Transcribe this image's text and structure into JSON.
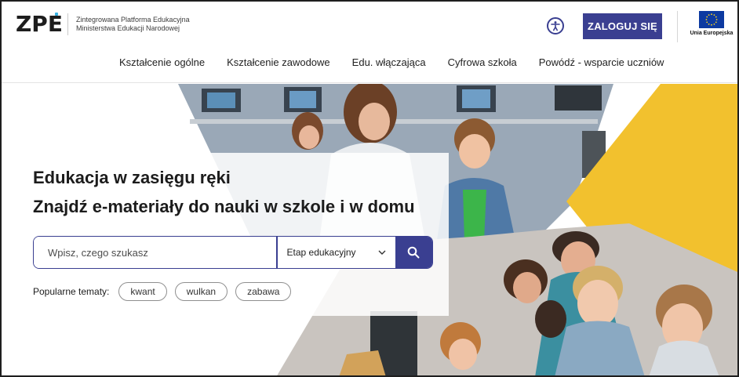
{
  "header": {
    "logo_text": "ZPE",
    "logo_line1": "Zintegrowana Platforma Edukacyjna",
    "logo_line2": "Ministerstwa Edukacji Narodowej",
    "login_label": "ZALOGUJ SIĘ",
    "eu_label": "Unia Europejska",
    "accent_color": "#3a3f91",
    "logo_accent_color": "#36b1e3"
  },
  "nav": {
    "items": [
      "Kształcenie ogólne",
      "Kształcenie zawodowe",
      "Edu. włączająca",
      "Cyfrowa szkoła",
      "Powódź - wsparcie uczniów"
    ]
  },
  "hero": {
    "line1": "Edukacja w zasięgu ręki",
    "line2": "Znajdź e-materiały do nauki w szkole i w domu",
    "search_placeholder": "Wpisz, czego szukasz",
    "stage_select": "Etap edukacyjny",
    "popular_label": "Popularne tematy:",
    "chips": [
      "kwant",
      "wulkan",
      "zabawa"
    ],
    "yellow_color": "#f2c12e"
  }
}
